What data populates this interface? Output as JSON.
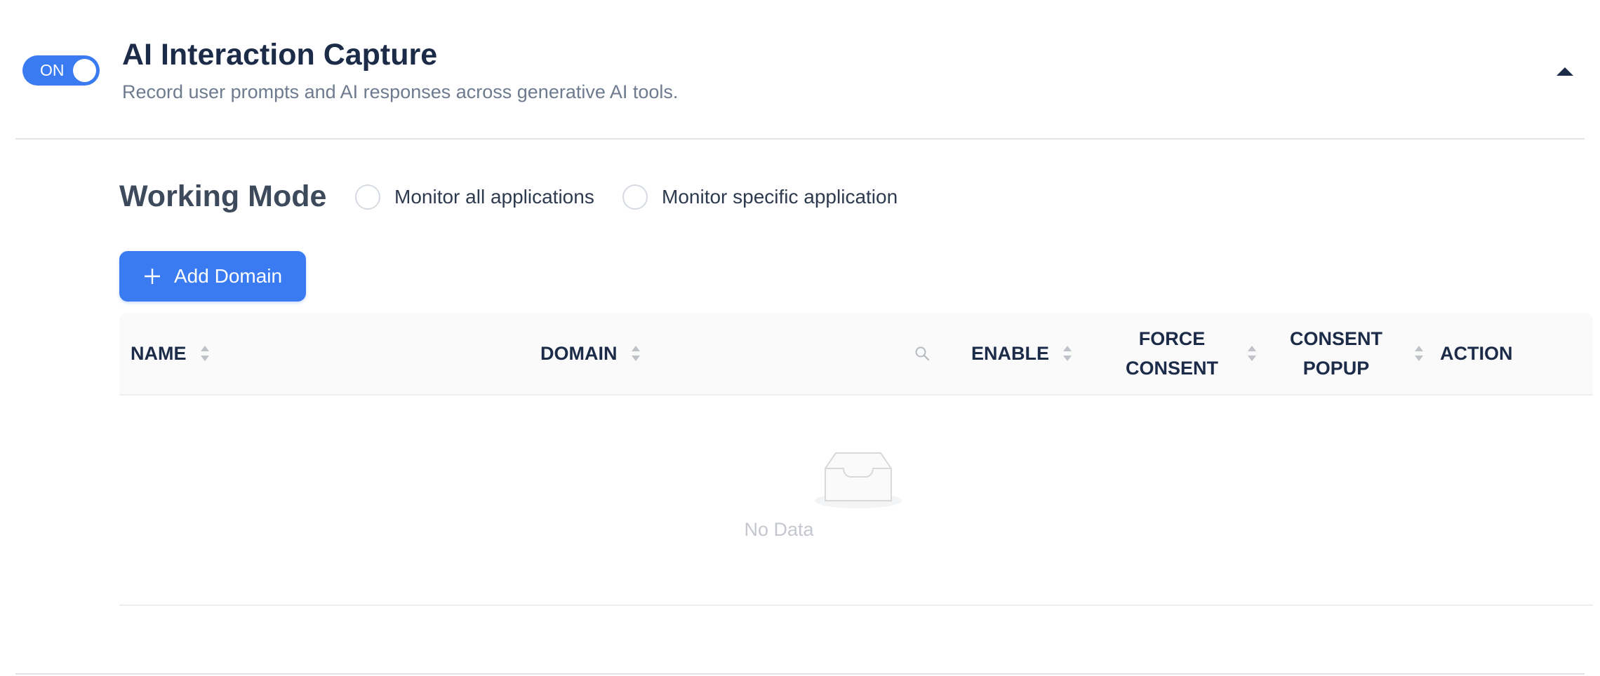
{
  "section": {
    "toggle_label": "ON",
    "toggle_on": true,
    "title": "AI Interaction Capture",
    "subtitle": "Record user prompts and AI responses across generative AI tools.",
    "collapse_icon": "caret-up-icon"
  },
  "working_mode": {
    "title": "Working Mode",
    "options": [
      {
        "label": "Monitor all applications",
        "selected": false
      },
      {
        "label": "Monitor specific application",
        "selected": false
      }
    ]
  },
  "add_button": {
    "label": "Add Domain",
    "icon": "plus-icon"
  },
  "table": {
    "columns": [
      {
        "label": "NAME",
        "sortable": true
      },
      {
        "label": "DOMAIN",
        "sortable": true,
        "searchable": true
      },
      {
        "label": "ENABLE",
        "sortable": true
      },
      {
        "label_line1": "FORCE",
        "label_line2": "CONSENT",
        "sortable": true
      },
      {
        "label_line1": "CONSENT",
        "label_line2": "POPUP",
        "sortable": true
      },
      {
        "label": "ACTION",
        "sortable": false
      }
    ],
    "rows": [],
    "empty_text": "No Data"
  },
  "colors": {
    "primary": "#3a7bf2",
    "title": "#1b2b48",
    "muted": "#6e7b8e"
  }
}
